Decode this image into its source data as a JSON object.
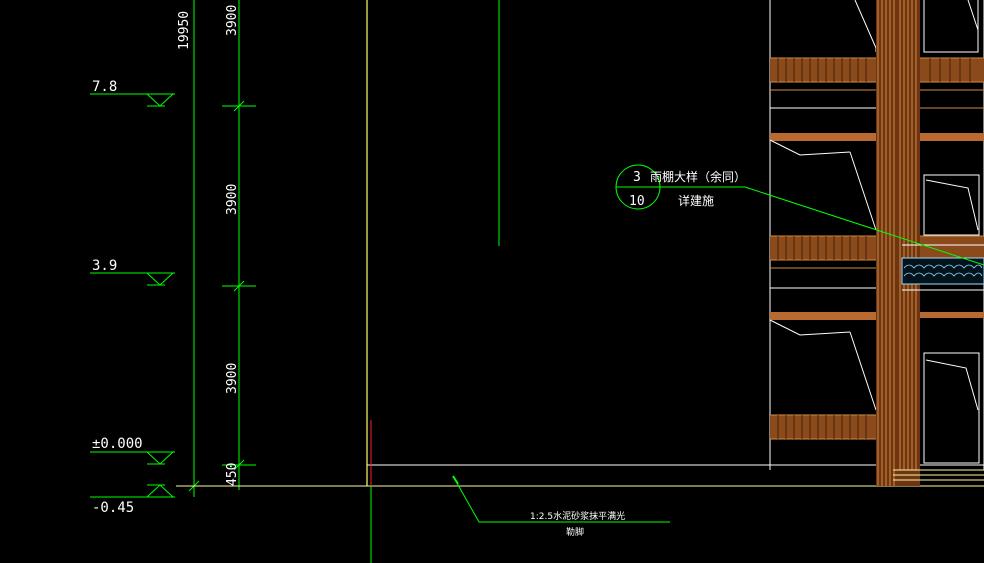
{
  "levels": {
    "l1": "7.8",
    "l2": "3.9",
    "l3": "±0.000",
    "l4": "-0.45"
  },
  "dimensions": {
    "total": "19950",
    "seg1": "3900",
    "seg2": "3900",
    "seg3": "3900",
    "seg4": "450"
  },
  "callout": {
    "detail_number": "3",
    "sheet_number": "10",
    "title": "雨棚大样（余同）",
    "subtitle": "详建施"
  },
  "ground_note": {
    "line1": "1:2.5水泥砂浆抹平满光",
    "line2": "勒脚"
  },
  "colors": {
    "background": "#000000",
    "dimension": "#00ff00",
    "text": "#ffffff",
    "wood": "#b8682a",
    "axis": "#ffff66",
    "red": "#ff2020"
  }
}
